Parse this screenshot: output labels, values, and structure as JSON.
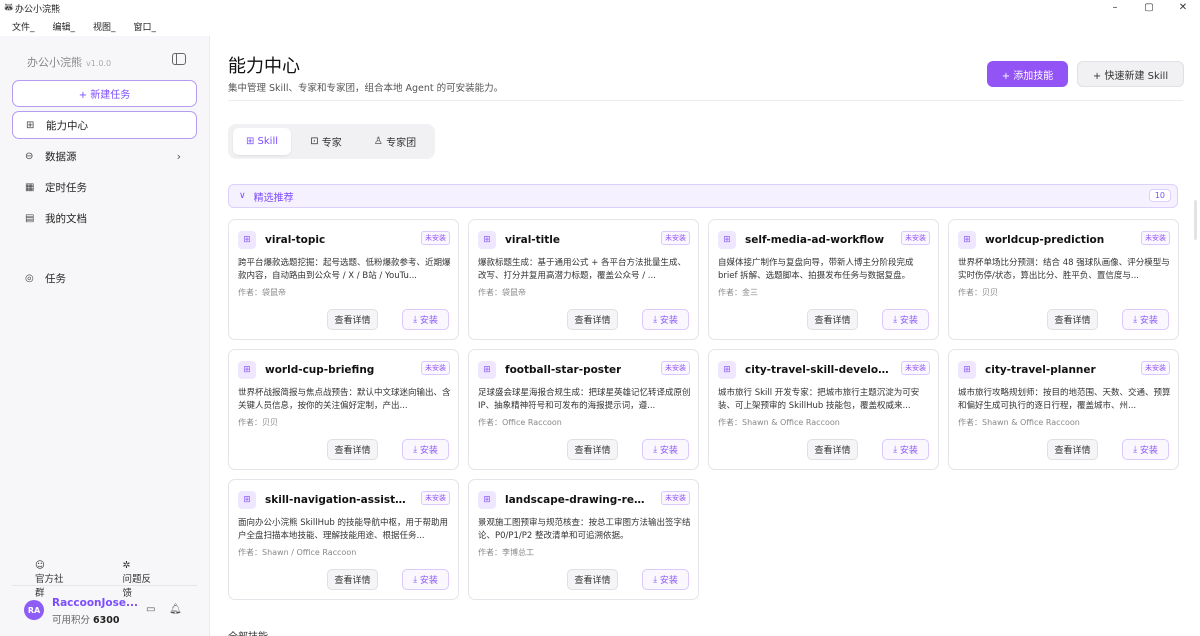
{
  "window": {
    "title": "办公小浣熊",
    "controls": {
      "minimize": "–",
      "maximize": "▢",
      "close": "✕"
    }
  },
  "menubar": [
    "文件_",
    "编辑_",
    "视图_",
    "窗口_"
  ],
  "sidebar": {
    "brand": "办公小浣熊",
    "version": "v1.0.0",
    "new_task": "+ 新建任务",
    "nav": [
      {
        "label": "能力中心",
        "icon": "grid-plus-icon",
        "active": true
      },
      {
        "label": "数据源",
        "icon": "database-icon",
        "active": false
      },
      {
        "label": "定时任务",
        "icon": "calendar-icon",
        "active": false
      },
      {
        "label": "我的文档",
        "icon": "document-icon",
        "active": false
      }
    ],
    "tasks_label": "任务",
    "footer": {
      "community": "官方社群",
      "feedback": "问题反馈"
    },
    "user": {
      "initials": "RA",
      "name": "RaccoonJose...",
      "points_label": "可用积分",
      "points": "6300"
    }
  },
  "main": {
    "title": "能力中心",
    "subtitle": "集中管理 Skill、专家和专家团，组合本地 Agent 的可安装能力。",
    "add_button": "+ 添加技能",
    "quick_button": "+ 快速新建 Skill",
    "tabs": [
      {
        "label": "Skill",
        "icon": "grid-plus-icon",
        "active": true
      },
      {
        "label": "专家",
        "icon": "robot-icon",
        "active": false
      },
      {
        "label": "专家团",
        "icon": "team-icon",
        "active": false
      }
    ],
    "section": {
      "label": "精选推荐",
      "count": "10"
    },
    "card_badge": "未安装",
    "card_detail": "查看详情",
    "card_install": "安装",
    "cards": [
      {
        "title": "viral-topic",
        "desc": "跨平台爆款选题挖掘：起号选题、低粉爆款参考、近期爆款内容，自动路由到公众号 / X / B站 / YouTu...",
        "author": "作者：袋鼠帝"
      },
      {
        "title": "viral-title",
        "desc": "爆款标题生成：基于通用公式 + 各平台方法批量生成、改写、打分并复用高潜力标题，覆盖公众号 / ...",
        "author": "作者：袋鼠帝"
      },
      {
        "title": "self-media-ad-workflow",
        "desc": "自媒体接广制作与复盘向导，带新人博主分阶段完成 brief 拆解、选题脚本、拍摄发布任务与数据复盘。",
        "author": "作者：金三"
      },
      {
        "title": "worldcup-prediction",
        "desc": "世界杯单场比分预测：结合 48 强球队画像、评分模型与实时伤停/状态，算出比分、胜平负、置信度与...",
        "author": "作者：贝贝"
      },
      {
        "title": "world-cup-briefing",
        "desc": "世界杯战报简报与焦点战预告：默认中文球迷向输出、含关键人员信息，按你的关注偏好定制，产出...",
        "author": "作者：贝贝"
      },
      {
        "title": "football-star-poster",
        "desc": "足球盛会球星海报合规生成：把球星英雄记忆转译成原创 IP、抽象精神符号和可发布的海报提示词，遵...",
        "author": "作者：Office Raccoon"
      },
      {
        "title": "city-travel-skill-developer",
        "desc": "城市旅行 Skill 开发专家：把城市旅行主题沉淀为可安装、可上架预审的 SkillHub 技能包，覆盖权威来...",
        "author": "作者：Shawn & Office Raccoon"
      },
      {
        "title": "city-travel-planner",
        "desc": "城市旅行攻略规划师：按目的地范围、天数、交通、预算和偏好生成可执行的逐日行程，覆盖城市、州...",
        "author": "作者：Shawn & Office Raccoon"
      },
      {
        "title": "skill-navigation-assistant-sl",
        "desc": "面向办公小浣熊 SkillHub 的技能导航中枢，用于帮助用户全盘扫描本地技能、理解技能用途、根据任务...",
        "author": "作者：Shawn / Office Raccoon"
      },
      {
        "title": "landscape-drawing-review...",
        "desc": "景观施工图预审与规范核查：按总工审图方法输出签字结论、P0/P1/P2 整改清单和可追溯依据。",
        "author": "作者：李博总工"
      }
    ],
    "next_section": "全部技能"
  }
}
